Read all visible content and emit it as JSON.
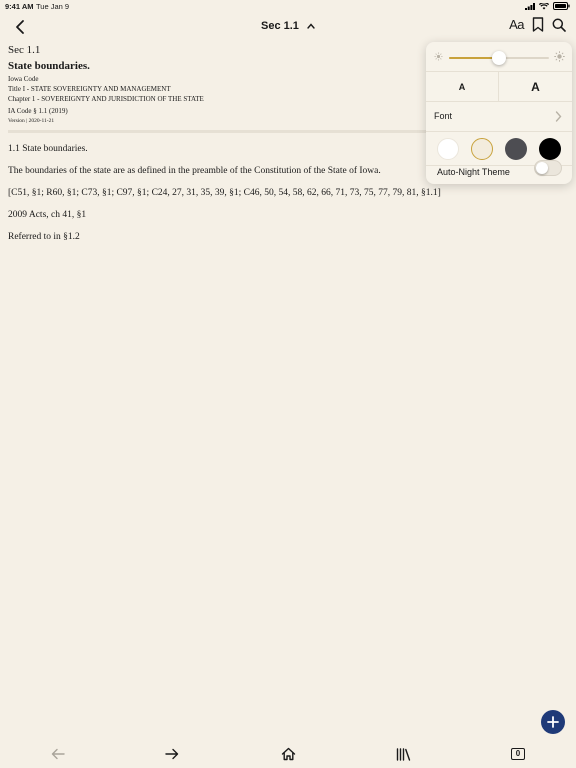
{
  "status_bar": {
    "time": "9:41 AM",
    "date": "Tue Jan 9"
  },
  "nav": {
    "title": "Sec 1.1",
    "aa_label": "Aa"
  },
  "document": {
    "section": "Sec 1.1",
    "heading": "State boundaries.",
    "code": "Iowa Code",
    "title_line": "Title I - STATE SOVEREIGNTY AND MANAGEMENT",
    "chapter_line": "Chapter 1 - SOVEREIGNTY AND JURISDICTION OF THE STATE",
    "citation": "IA Code § 1.1 (2019)",
    "version": "Version | 2020-11-21",
    "paragraphs": [
      "1.1 State boundaries.",
      "The boundaries of the state are as defined in the preamble of the Constitution of the State of Iowa.",
      "[C51, §1; R60, §1; C73, §1; C97, §1; C24, 27, 31, 35, 39, §1; C46, 50, 54, 58, 62, 66, 71, 73, 75, 77, 79, 81, §1.1]",
      "2009 Acts, ch 41, §1",
      "Referred to in §1.2"
    ]
  },
  "popover": {
    "brightness": 0.5,
    "font_small": "A",
    "font_large": "A",
    "font_label": "Font",
    "themes": [
      {
        "name": "white",
        "color": "#ffffff",
        "selected": false
      },
      {
        "name": "sepia",
        "color": "#f3ecdd",
        "selected": true
      },
      {
        "name": "gray",
        "color": "#4d4d52",
        "selected": false
      },
      {
        "name": "night",
        "color": "#000000",
        "selected": false
      }
    ],
    "auto_night_label": "Auto-Night Theme",
    "auto_night_on": false
  },
  "bottom_bar": {
    "tab_count": "0"
  },
  "colors": {
    "accent": "#c8a23c",
    "fab": "#1f3a78",
    "background": "#f5f0e6"
  }
}
